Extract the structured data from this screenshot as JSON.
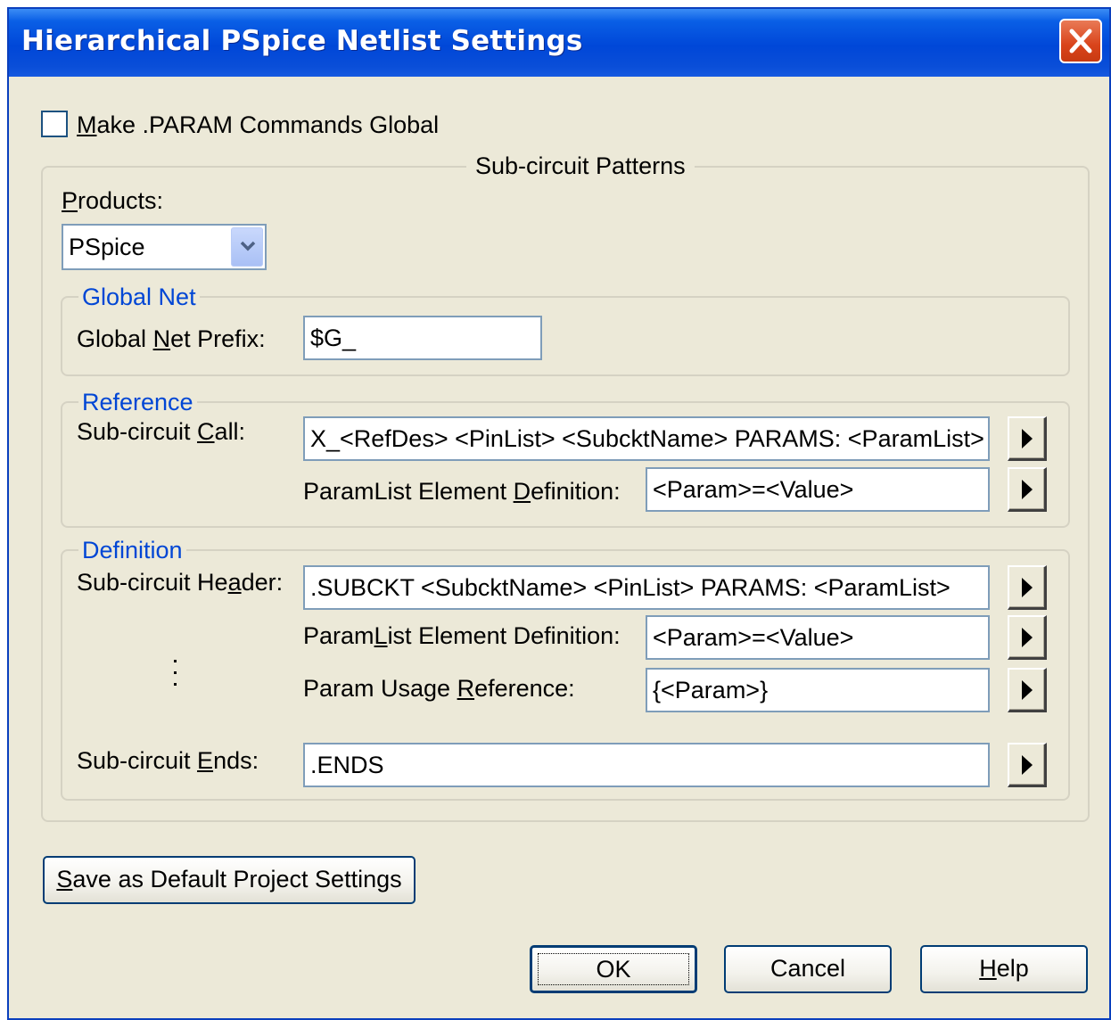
{
  "window": {
    "title": "Hierarchical PSpice Netlist Settings"
  },
  "make_param": {
    "label_u": "M",
    "label_rest": "ake .PARAM Commands Global",
    "checked": false
  },
  "subcircuit_patterns": {
    "legend": "Sub-circuit Patterns",
    "products": {
      "label_u": "P",
      "label_rest": "roducts:",
      "selected": "PSpice"
    },
    "global_net": {
      "legend": "Global Net",
      "prefix_label_a": "Global ",
      "prefix_label_u": "N",
      "prefix_label_b": "et Prefix:",
      "prefix_value": "$G_"
    },
    "reference": {
      "legend": "Reference",
      "call_label_a": "Sub-circuit ",
      "call_label_u": "C",
      "call_label_b": "all:",
      "call_value": "X_<RefDes> <PinList> <SubcktName> PARAMS: <ParamList>",
      "paramlist_label_a": "ParamList Element ",
      "paramlist_label_u": "D",
      "paramlist_label_b": "efinition:",
      "paramlist_value": "<Param>=<Value>"
    },
    "definition": {
      "legend": "Definition",
      "header_label_a": "Sub-circuit He",
      "header_label_u": "a",
      "header_label_b": "der:",
      "header_value": ".SUBCKT <SubcktName> <PinList> PARAMS: <ParamList>",
      "paramlist_label_a": "Param",
      "paramlist_label_u": "L",
      "paramlist_label_b": "ist Element Definition:",
      "paramlist_value": "<Param>=<Value>",
      "usage_label_a": "Param Usage ",
      "usage_label_u": "R",
      "usage_label_b": "eference:",
      "usage_value": "{<Param>}",
      "ends_label_a": "Sub-circuit ",
      "ends_label_u": "E",
      "ends_label_b": "nds:",
      "ends_value": ".ENDS"
    }
  },
  "buttons": {
    "save_default_u": "S",
    "save_default_rest": "ave as Default Project Settings",
    "ok": "OK",
    "cancel": "Cancel",
    "help_u": "H",
    "help_rest": "elp"
  },
  "icons": {
    "close": "close-icon",
    "dropdown": "chevron-down-icon",
    "insert_arrow": "triangle-right-icon"
  },
  "colors": {
    "title_bar": "#0047d8",
    "dialog_bg": "#ece9d8",
    "group_legend": "#0046d5",
    "close_button": "#d9441b"
  }
}
